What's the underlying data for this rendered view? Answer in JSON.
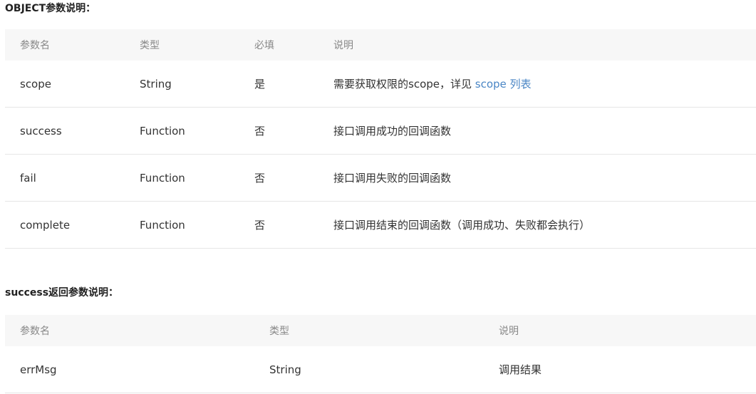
{
  "object_section": {
    "title": "OBJECT参数说明：",
    "headers": [
      "参数名",
      "类型",
      "必填",
      "说明"
    ],
    "rows": [
      {
        "name": "scope",
        "type": "String",
        "required": "是",
        "desc": "需要获取权限的scope，详见",
        "link": "scope 列表"
      },
      {
        "name": "success",
        "type": "Function",
        "required": "否",
        "desc": "接口调用成功的回调函数"
      },
      {
        "name": "fail",
        "type": "Function",
        "required": "否",
        "desc": "接口调用失败的回调函数"
      },
      {
        "name": "complete",
        "type": "Function",
        "required": "否",
        "desc": "接口调用结束的回调函数（调用成功、失败都会执行）"
      }
    ]
  },
  "success_section": {
    "title": "success返回参数说明：",
    "headers": [
      "参数名",
      "类型",
      "说明"
    ],
    "rows": [
      {
        "name": "errMsg",
        "type": "String",
        "desc": "调用结果"
      }
    ]
  },
  "colors": {
    "header_bg": "#f7f7f7",
    "link": "#4a86c5",
    "border": "#e6e6e6"
  }
}
